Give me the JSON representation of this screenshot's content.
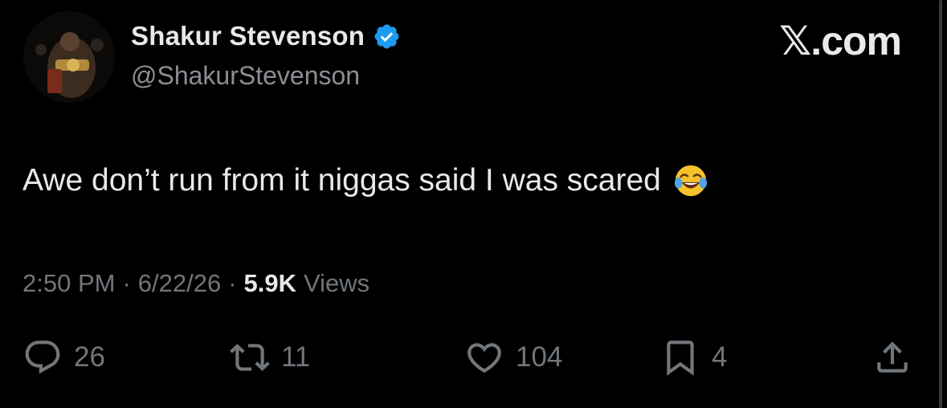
{
  "author": {
    "display_name": "Shakur Stevenson",
    "handle": "@ShakurStevenson",
    "verified_icon": "verified-badge-icon",
    "verified_color": "#1d9bf0"
  },
  "brand": {
    "label": "𝕏.com"
  },
  "tweet": {
    "text": "Awe don’t run from it niggas said I was scared",
    "emoji": "face-with-tears-of-joy"
  },
  "meta": {
    "time": "2:50 PM",
    "separator": "·",
    "date": "6/22/26",
    "views_count": "5.9K",
    "views_label": "Views"
  },
  "actions": {
    "replies": "26",
    "reposts": "11",
    "likes": "104",
    "bookmarks": "4"
  },
  "colors": {
    "background": "#000000",
    "primary_text": "#e7e9ea",
    "secondary_text": "#71767b",
    "accent": "#1d9bf0"
  }
}
